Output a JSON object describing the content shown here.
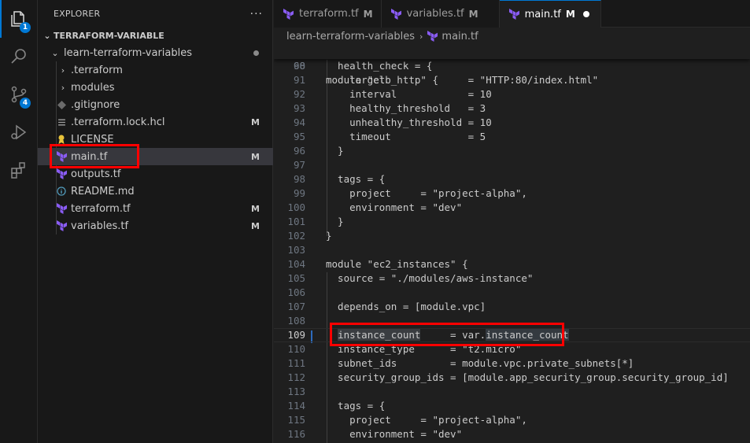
{
  "activity_bar": {
    "explorer_badge": "1",
    "scm_badge": "4"
  },
  "sidebar": {
    "title": "EXPLORER",
    "more": "···",
    "root_label": "TERRAFORM-VARIABLE",
    "folder_label": "learn-terraform-variables",
    "items": [
      {
        "label": ".terraform",
        "type": "folder",
        "status": ""
      },
      {
        "label": "modules",
        "type": "folder",
        "status": ""
      },
      {
        "label": ".gitignore",
        "type": "file",
        "status": ""
      },
      {
        "label": ".terraform.lock.hcl",
        "type": "file",
        "status": "M"
      },
      {
        "label": "LICENSE",
        "type": "file",
        "status": ""
      },
      {
        "label": "main.tf",
        "type": "file",
        "status": "M"
      },
      {
        "label": "outputs.tf",
        "type": "file",
        "status": ""
      },
      {
        "label": "README.md",
        "type": "file",
        "status": ""
      },
      {
        "label": "terraform.tf",
        "type": "file",
        "status": "M"
      },
      {
        "label": "variables.tf",
        "type": "file",
        "status": "M"
      }
    ]
  },
  "tabs": [
    {
      "label": "terraform.tf",
      "status": "M"
    },
    {
      "label": "variables.tf",
      "status": "M"
    },
    {
      "label": "main.tf",
      "status": "M"
    }
  ],
  "breadcrumb": {
    "folder": "learn-terraform-variables",
    "file": "main.tf"
  },
  "editor": {
    "sticky": {
      "num": "68",
      "code": "module \"elb_http\" {"
    },
    "lines": [
      {
        "num": "90",
        "code": "  health_check = {"
      },
      {
        "num": "91",
        "code": "    target              = \"HTTP:80/index.html\""
      },
      {
        "num": "92",
        "code": "    interval            = 10"
      },
      {
        "num": "93",
        "code": "    healthy_threshold   = 3"
      },
      {
        "num": "94",
        "code": "    unhealthy_threshold = 10"
      },
      {
        "num": "95",
        "code": "    timeout             = 5"
      },
      {
        "num": "96",
        "code": "  }"
      },
      {
        "num": "97",
        "code": ""
      },
      {
        "num": "98",
        "code": "  tags = {"
      },
      {
        "num": "99",
        "code": "    project     = \"project-alpha\","
      },
      {
        "num": "100",
        "code": "    environment = \"dev\""
      },
      {
        "num": "101",
        "code": "  }"
      },
      {
        "num": "102",
        "code": "}"
      },
      {
        "num": "103",
        "code": ""
      },
      {
        "num": "104",
        "code": "module \"ec2_instances\" {"
      },
      {
        "num": "105",
        "code": "  source = \"./modules/aws-instance\""
      },
      {
        "num": "106",
        "code": ""
      },
      {
        "num": "107",
        "code": "  depends_on = [module.vpc]"
      },
      {
        "num": "108",
        "code": ""
      },
      {
        "num": "109",
        "code": "  instance_count     = var.instance_count"
      },
      {
        "num": "110",
        "code": "  instance_type      = \"t2.micro\""
      },
      {
        "num": "111",
        "code": "  subnet_ids         = module.vpc.private_subnets[*]"
      },
      {
        "num": "112",
        "code": "  security_group_ids = [module.app_security_group.security_group_id]"
      },
      {
        "num": "113",
        "code": ""
      },
      {
        "num": "114",
        "code": "  tags = {"
      },
      {
        "num": "115",
        "code": "    project     = \"project-alpha\","
      },
      {
        "num": "116",
        "code": "    environment = \"dev\""
      }
    ]
  },
  "colors": {
    "accent": "#0078d4",
    "terraform_icon": "#8a5cf5",
    "annotation": "#ff0000"
  }
}
